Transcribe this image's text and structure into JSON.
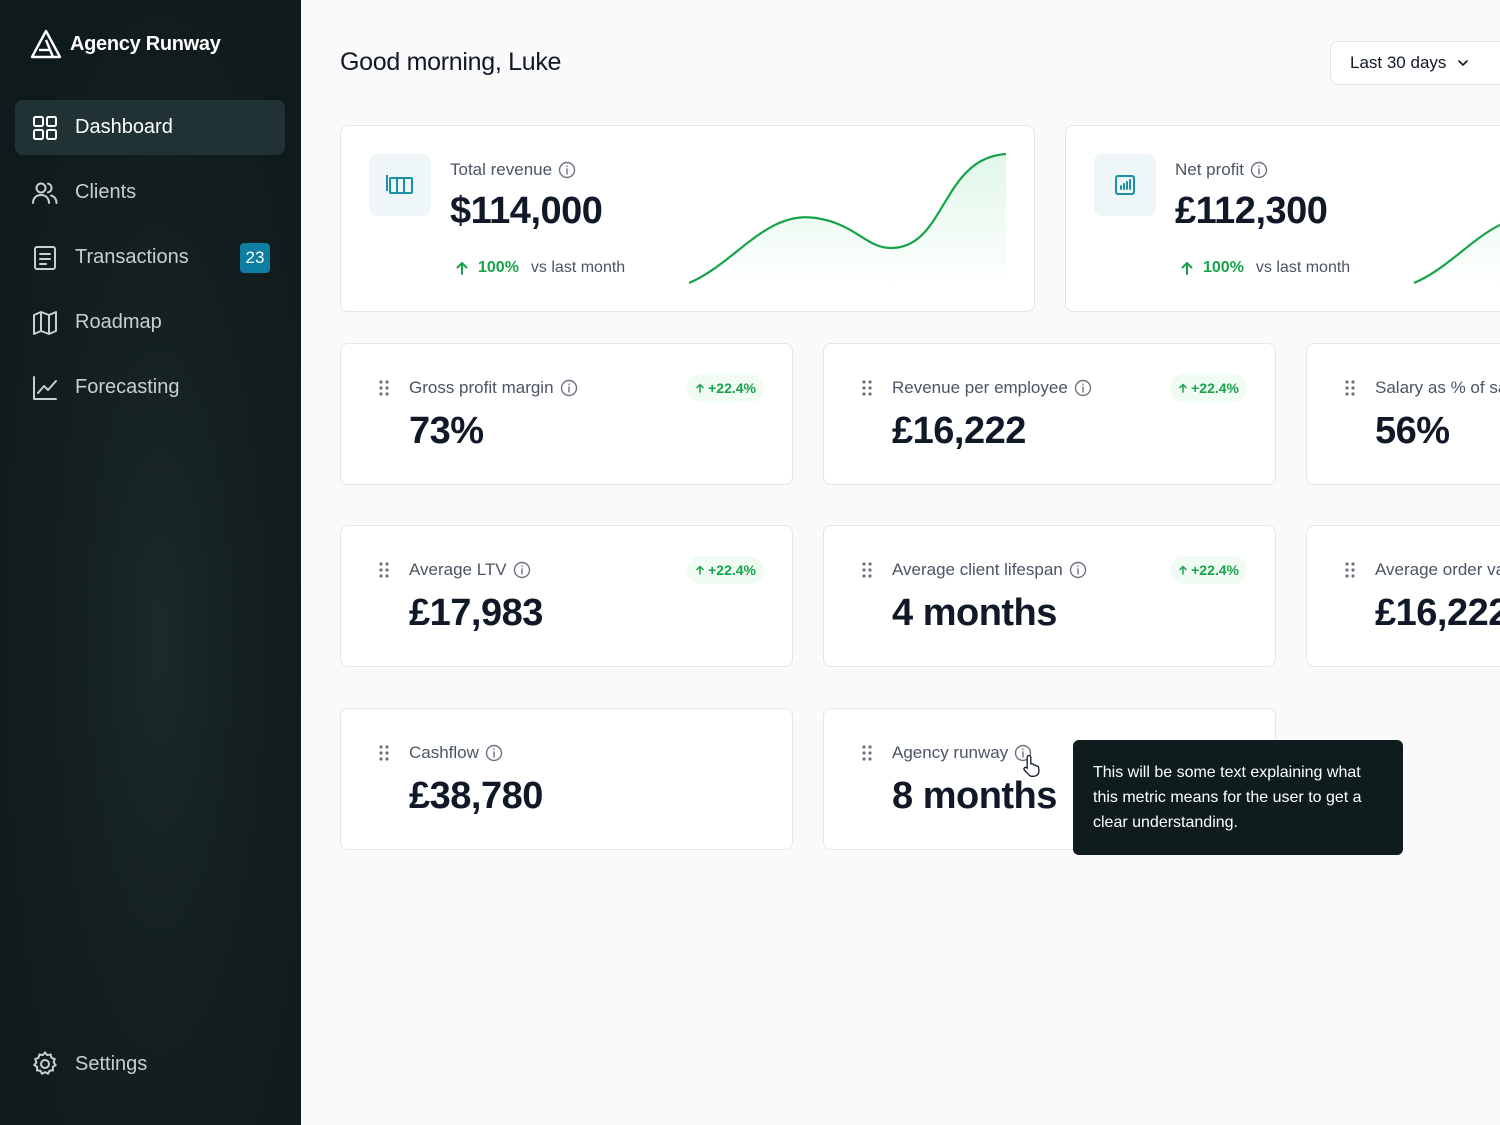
{
  "app": {
    "name": "Agency Runway"
  },
  "sidebar": {
    "items": [
      {
        "label": "Dashboard",
        "icon": "grid-icon",
        "active": true
      },
      {
        "label": "Clients",
        "icon": "users-icon"
      },
      {
        "label": "Transactions",
        "icon": "document-icon",
        "badge": "23"
      },
      {
        "label": "Roadmap",
        "icon": "map-icon"
      },
      {
        "label": "Forecasting",
        "icon": "line-chart-icon"
      }
    ],
    "settings_label": "Settings"
  },
  "header": {
    "greeting": "Good morning, Luke",
    "range_label": "Last 30 days"
  },
  "summary": [
    {
      "label": "Total revenue",
      "value": "$114,000",
      "change": "100%",
      "change_note": "vs last month",
      "icon": "table-columns-icon"
    },
    {
      "label": "Net profit",
      "value": "£112,300",
      "change": "100%",
      "change_note": "vs last month",
      "icon": "bar-chart-icon"
    }
  ],
  "metrics": [
    {
      "label": "Gross profit margin",
      "value": "73%",
      "badge": "+22.4%"
    },
    {
      "label": "Revenue per employee",
      "value": "£16,222",
      "badge": "+22.4%"
    },
    {
      "label": "Salary as % of sa",
      "value": "56%"
    },
    {
      "label": "Average LTV",
      "value": "£17,983",
      "badge": "+22.4%"
    },
    {
      "label": "Average client lifespan",
      "value": "4 months",
      "badge": "+22.4%"
    },
    {
      "label": "Average order va",
      "value": "£16,222"
    },
    {
      "label": "Cashflow",
      "value": "£38,780"
    },
    {
      "label": "Agency runway",
      "value": "8 months"
    }
  ],
  "tooltip": {
    "text": "This will be some text explaining what this metric means for the user to get a clear understanding."
  },
  "colors": {
    "sidebar_bg": "#0e1a1c",
    "accent_green": "#16a34a",
    "badge_blue": "#0e7fa3",
    "icon_teal": "#1b8fa8"
  }
}
